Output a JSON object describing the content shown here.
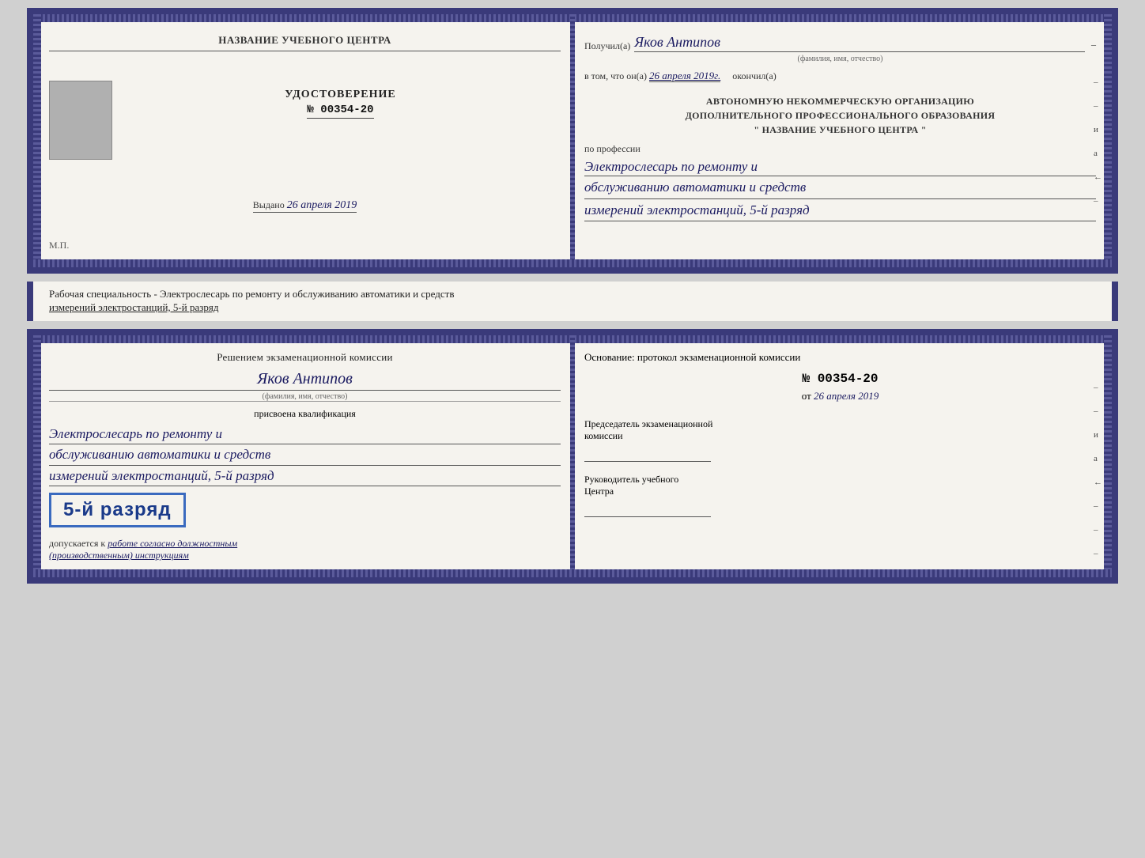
{
  "top_left": {
    "org_title": "НАЗВАНИЕ УЧЕБНОГО ЦЕНТРА",
    "cert_label": "УДОСТОВЕРЕНИЕ",
    "cert_number": "№ 00354-20",
    "issued_label": "Выдано",
    "issued_date": "26 апреля 2019",
    "stamp": "М.П."
  },
  "top_right": {
    "recipient_prefix": "Получил(а)",
    "recipient_name": "Яков Антипов",
    "fio_hint": "(фамилия, имя, отчество)",
    "date_prefix": "в том, что он(а)",
    "date_value": "26 апреля 2019г.",
    "date_suffix": "окончил(а)",
    "org_line1": "АВТОНОМНУЮ НЕКОММЕРЧЕСКУЮ ОРГАНИЗАЦИЮ",
    "org_line2": "ДОПОЛНИТЕЛЬНОГО ПРОФЕССИОНАЛЬНОГО ОБРАЗОВАНИЯ",
    "org_line3": "\"   НАЗВАНИЕ УЧЕБНОГО ЦЕНТРА   \"",
    "profession_label": "по профессии",
    "profession_line1": "Электрослесарь по ремонту и",
    "profession_line2": "обслуживанию автоматики и средств",
    "profession_line3": "измерений электростанций, 5-й разряд"
  },
  "middle_band": {
    "text": "Рабочая специальность - Электрослесарь по ремонту и обслуживанию автоматики и средств",
    "text2": "измерений электростанций, 5-й разряд"
  },
  "bottom_left": {
    "commission_title": "Решением экзаменационной комиссии",
    "person_name": "Яков Антипов",
    "fio_hint": "(фамилия, имя, отчество)",
    "qualification_label": "присвоена квалификация",
    "qual_line1": "Электрослесарь по ремонту и",
    "qual_line2": "обслуживанию автоматики и средств",
    "qual_line3": "измерений электростанций, 5-й разряд",
    "rank_text": "5-й разряд",
    "dopusk_prefix": "допускается к",
    "dopusk_text": "работе согласно должностным",
    "dopusk_text2": "(производственным) инструкциям"
  },
  "bottom_right": {
    "basis_text": "Основание: протокол экзаменационной  комиссии",
    "protocol_number": "№  00354-20",
    "protocol_date_prefix": "от",
    "protocol_date": "26 апреля 2019",
    "chairman_line1": "Председатель экзаменационной",
    "chairman_line2": "комиссии",
    "head_line1": "Руководитель учебного",
    "head_line2": "Центра"
  },
  "side_marks": {
    "mark1": "–",
    "mark2": "–",
    "mark3": "а",
    "mark4": "←",
    "mark5": "–"
  }
}
